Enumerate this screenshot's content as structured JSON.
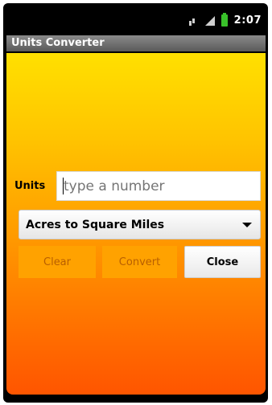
{
  "status_bar": {
    "time": "2:07",
    "icons": [
      "signal-icon",
      "cellular-icon",
      "battery-icon"
    ]
  },
  "app": {
    "title": "Units Converter"
  },
  "form": {
    "units_label": "Units",
    "units_input": {
      "value": "",
      "placeholder": "type a number"
    },
    "conversion_select": {
      "selected": "Acres to Square Miles"
    },
    "buttons": {
      "clear": "Clear",
      "convert": "Convert",
      "close": "Close"
    }
  },
  "colors": {
    "gradient_top": "#ffe000",
    "gradient_bottom": "#ff5500",
    "button_orange": "#ffa200",
    "battery_green": "#39c12a"
  }
}
